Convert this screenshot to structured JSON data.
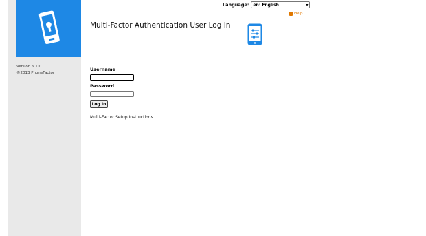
{
  "sidebar": {
    "version": "Version 6.1.0",
    "copyright": "©2013 PhoneFactor",
    "logo_icon": "phone-lock-icon",
    "logo_color": "#1e88e5"
  },
  "header": {
    "language_label": "Language:",
    "language_selected": "en: English",
    "help_label": "Help",
    "title": "Multi-Factor Authentication User Log In"
  },
  "form": {
    "username_label": "Username",
    "username_value": "",
    "password_label": "Password",
    "password_value": "",
    "login_label": "Log In"
  },
  "links": {
    "setup_instructions": "Multi-Factor Setup Instructions"
  },
  "colors": {
    "accent": "#1e88e5",
    "help": "#e07800",
    "sidebar_bg": "#e9e9e9"
  }
}
